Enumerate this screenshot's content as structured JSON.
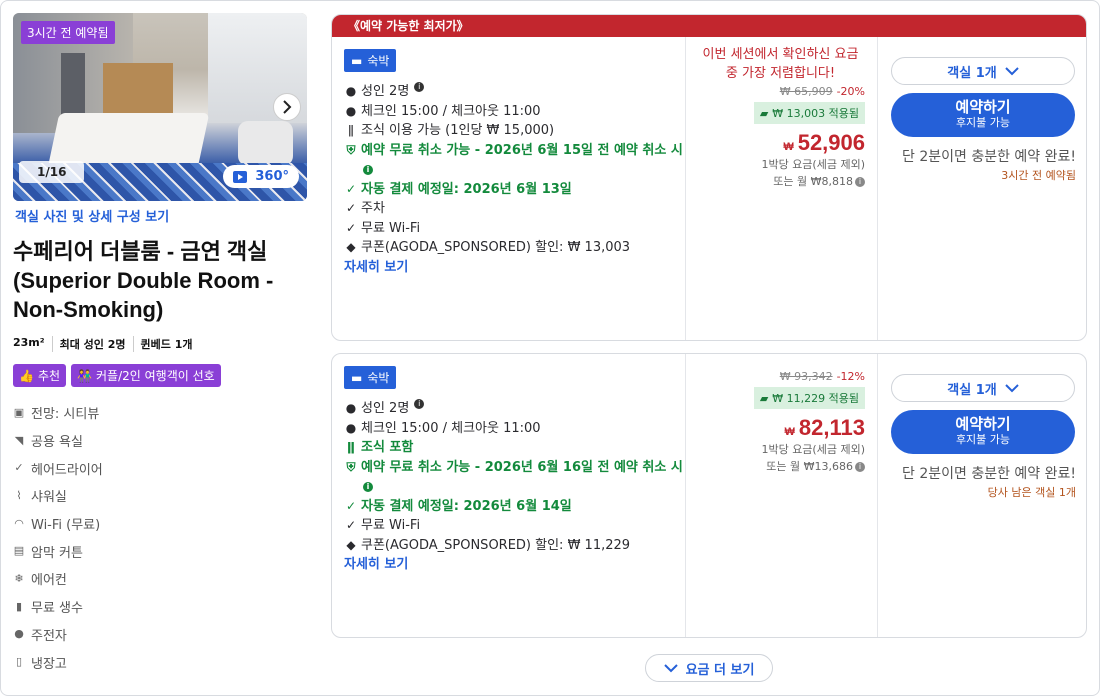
{
  "photo": {
    "booked_badge": "3시간 전 예약됨",
    "counter": "1/16",
    "btn_360": "360°",
    "link": "객실 사진 및 상세 구성 보기"
  },
  "room": {
    "title": "수페리어 더블룸 - 금연 객실 (Superior Double Room -Non-Smoking)",
    "size": "23m²",
    "max_guests": "최대 성인 2명",
    "bed": "퀸베드 1개",
    "tags": [
      "추천",
      "커플/2인 여행객이 선호"
    ],
    "amenities": [
      {
        "icon": "view-icon",
        "label": "전망: 시티뷰"
      },
      {
        "icon": "bath-icon",
        "label": "공용 욕실"
      },
      {
        "icon": "check-icon",
        "label": "헤어드라이어"
      },
      {
        "icon": "shower-icon",
        "label": "샤워실"
      },
      {
        "icon": "wifi-icon",
        "label": "Wi-Fi (무료)"
      },
      {
        "icon": "curtain-icon",
        "label": "암막 커튼"
      },
      {
        "icon": "aircon-icon",
        "label": "에어컨"
      },
      {
        "icon": "water-icon",
        "label": "무료 생수"
      },
      {
        "icon": "bicycle-icon",
        "label": "주전자"
      },
      {
        "icon": "fridge-icon",
        "label": "냉장고"
      }
    ]
  },
  "offers": [
    {
      "banner": "《예약 가능한 최저가》",
      "stay": "숙박",
      "guests": "성인 2명",
      "checkin": "체크인 15:00 / 체크아웃 11:00",
      "meal": "조식 이용 가능 (1인당 ₩ 15,000)",
      "cancel": "예약 무료 취소 가능 - 2026년 6월 15일 전 예약 취소 시",
      "payment": "자동 결제 예정일: 2026년 6월 13일",
      "extras": [
        "주차",
        "무료 Wi-Fi"
      ],
      "coupon_line": "쿠폰(AGODA_SPONSORED) 할인: ₩ 13,003",
      "detail": "자세히 보기",
      "lowest_msg": "이번 세션에서 확인하신 요금 중 가장 저렴합니다!",
      "original_price": "₩ 65,909",
      "discount": "-20%",
      "coupon_applied": "₩ 13,003 적용됨",
      "currency": "₩",
      "price": "52,906",
      "per_night": "1박당 요금(세금 제외)",
      "monthly": "또는 월 ₩8,818",
      "room_select": "객실 1개",
      "book": "예약하기",
      "book_sub": "후지불 가능",
      "hurry": "단 2분이면 충분한 예약 완료!",
      "hurry_sub": "3시간 전 예약됨"
    },
    {
      "stay": "숙박",
      "guests": "성인 2명",
      "checkin": "체크인 15:00 / 체크아웃 11:00",
      "meal": "조식 포함",
      "cancel": "예약 무료 취소 가능 - 2026년 6월 16일 전 예약 취소 시",
      "payment": "자동 결제 예정일: 2026년 6월 14일",
      "extras": [
        "무료 Wi-Fi"
      ],
      "coupon_line": "쿠폰(AGODA_SPONSORED) 할인: ₩ 11,229",
      "detail": "자세히 보기",
      "original_price": "₩ 93,342",
      "discount": "-12%",
      "coupon_applied": "₩ 11,229 적용됨",
      "currency": "₩",
      "price": "82,113",
      "per_night": "1박당 요금(세금 제외)",
      "monthly": "또는 월 ₩13,686",
      "room_select": "객실 1개",
      "book": "예약하기",
      "book_sub": "후지불 가능",
      "hurry": "단 2분이면 충분한 예약 완료!",
      "hurry_sub": "당사 남은 객실 1개"
    }
  ],
  "more_rates": "요금 더 보기",
  "colors": {
    "accent": "#2560d8",
    "price": "#c2262e",
    "success": "#138a3c",
    "badge": "#8a3fd6"
  }
}
